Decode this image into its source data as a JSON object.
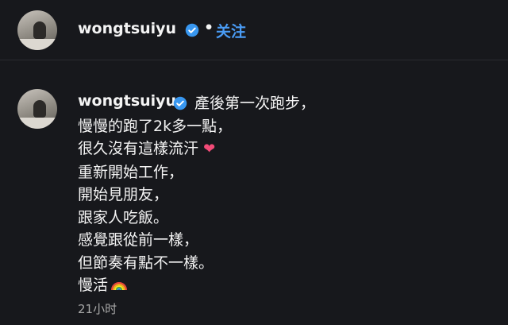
{
  "header": {
    "username": "wongtsuiyu",
    "separator": "•",
    "follow_label": "关注"
  },
  "post": {
    "username": "wongtsuiyu",
    "caption_lines": [
      "產後第一次跑步，",
      "慢慢的跑了2k多一點，",
      "很久沒有這樣流汗",
      "重新開始工作，",
      "開始見朋友，",
      "跟家人吃飯。",
      "感覺跟從前一樣，",
      "但節奏有點不一樣。",
      "慢活"
    ],
    "emoji_heart": "❤",
    "time": "21小时"
  },
  "colors": {
    "background": "#17181c",
    "accent_link": "#4a9cf5",
    "verified_badge": "#3897f0",
    "heart": "#f34b78"
  },
  "icons": {
    "verified": "verified-badge-icon",
    "heart": "heart-emoji-icon",
    "rainbow": "rainbow-emoji-icon"
  }
}
